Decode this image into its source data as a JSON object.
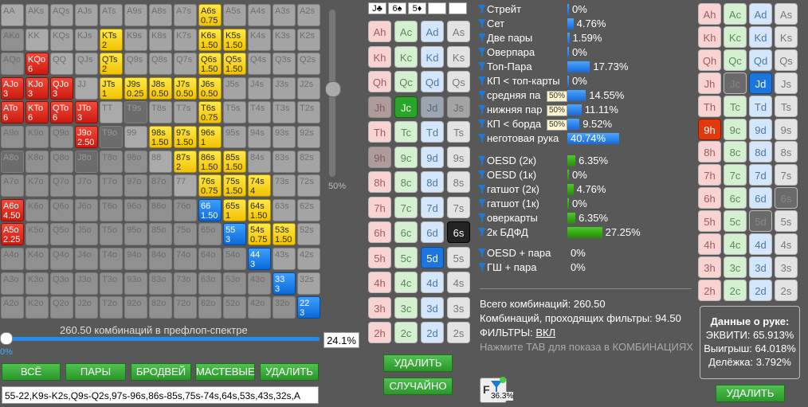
{
  "board": [
    "J♣",
    "6♠",
    "5♦",
    "",
    ""
  ],
  "preflop": {
    "summary": "260.50 комбинаций в префлоп-спектре",
    "percent": "24.1%",
    "vslider_label": "50%",
    "hslider_label": "0%"
  },
  "buttons": {
    "all": "ВСЁ",
    "pairs": "ПАРЫ",
    "broadway": "БРОДВЕЙ",
    "suited": "МАСТЕВЫЕ",
    "delete": "УДАЛИТЬ",
    "delete2": "УДАЛИТЬ",
    "random": "СЛУЧАЙНО",
    "delete3": "УДАЛИТЬ"
  },
  "range_text": "55-22,K9s-K2s,Q9s-Q2s,97s-96s,86s-85s,75s-74s,64s,53s,43s,32s,A",
  "stats": [
    {
      "label": "Стрейт",
      "value": "0%",
      "pct": 0
    },
    {
      "label": "Сет",
      "value": "4.76%",
      "pct": 4.76
    },
    {
      "label": "Две пары",
      "value": "1.59%",
      "pct": 1.59
    },
    {
      "label": "Оверпара",
      "value": "0%",
      "pct": 0
    },
    {
      "label": "Топ-Пара",
      "value": "17.73%",
      "pct": 17.73
    },
    {
      "label": "КП < топ-карты",
      "value": "0%",
      "pct": 0
    },
    {
      "label": "средняя па",
      "value": "14.55%",
      "pct": 14.55,
      "tag": "50%"
    },
    {
      "label": "нижняя пар",
      "value": "11.11%",
      "pct": 11.11,
      "tag": "50%"
    },
    {
      "label": "КП < борда",
      "value": "9.52%",
      "pct": 9.52,
      "tag": "50%"
    },
    {
      "label": "неготовая рука",
      "value": "40.74%",
      "pct": 40.74
    }
  ],
  "draws": [
    {
      "label": "OESD (2к)",
      "value": "6.35%",
      "pct": 6.35
    },
    {
      "label": "OESD (1к)",
      "value": "0%",
      "pct": 0
    },
    {
      "label": "гатшот (2к)",
      "value": "4.76%",
      "pct": 4.76
    },
    {
      "label": "гатшот (1к)",
      "value": "0%",
      "pct": 0
    },
    {
      "label": "оверкарты",
      "value": "6.35%",
      "pct": 6.35
    },
    {
      "label": "2к БДФД",
      "value": "27.25%",
      "pct": 27.25
    }
  ],
  "combos": [
    {
      "label": "OESD + пара",
      "value": "0%"
    },
    {
      "label": "ГШ + пара",
      "value": "0%"
    }
  ],
  "totals": {
    "total": "Всего комбинаций: 260.50",
    "passing": "Комбинаций, проходящих фильтры: 94.50",
    "filters_label": "ФИЛЬТРЫ:",
    "filters_value": "ВКЛ",
    "hint": "Нажмите TAB для показа в КОМБИНАЦИЯХ"
  },
  "filter_badge": "36.3%",
  "hand_data": {
    "title": "Данные о руке:",
    "equity": "ЭКВИТИ: 65.913%",
    "win": "Выигрыш: 64.018%",
    "tie": "Делёжка: 3.792%"
  },
  "ranks": [
    "A",
    "K",
    "Q",
    "J",
    "T",
    "9",
    "8",
    "7",
    "6",
    "5",
    "4",
    "3",
    "2"
  ],
  "matrix_marked": {
    "A6s": [
      "y",
      "0.75"
    ],
    "K6s": [
      "y",
      "1.50"
    ],
    "K5s": [
      "y",
      "1.50"
    ],
    "KTs": [
      "y",
      "2"
    ],
    "QTs": [
      "y",
      "2"
    ],
    "Q6s": [
      "y",
      "1.50"
    ],
    "Q5s": [
      "y",
      "1.50"
    ],
    "KQo": [
      "r",
      "6"
    ],
    "AJo": [
      "r",
      "3"
    ],
    "KJo": [
      "r",
      "3"
    ],
    "QJo": [
      "r",
      "3"
    ],
    "JTs": [
      "y",
      "1"
    ],
    "J9s": [
      "y",
      "0.25"
    ],
    "J8s": [
      "y",
      "0.50"
    ],
    "J7s": [
      "y",
      "0.50"
    ],
    "J6s": [
      "y",
      "0.50"
    ],
    "ATo": [
      "r",
      "6"
    ],
    "KTo": [
      "r",
      "6"
    ],
    "QTo": [
      "r",
      "6"
    ],
    "JTo": [
      "r",
      "3"
    ],
    "T6s": [
      "y",
      "0.75"
    ],
    "J9o": [
      "r",
      "2.50"
    ],
    "98s": [
      "y",
      "1.50"
    ],
    "97s": [
      "y",
      "1.50"
    ],
    "96s": [
      "y",
      "1"
    ],
    "87s": [
      "y",
      "2"
    ],
    "86s": [
      "y",
      "1.50"
    ],
    "85s": [
      "y",
      "1.50"
    ],
    "76s": [
      "y",
      "0.75"
    ],
    "75s": [
      "y",
      "1.50"
    ],
    "74s": [
      "y",
      "4"
    ],
    "A6o": [
      "r",
      "4.50"
    ],
    "66": [
      "b",
      "1.50"
    ],
    "65s": [
      "y",
      "1"
    ],
    "64s": [
      "y",
      "1.50"
    ],
    "A5o": [
      "r",
      "2.25"
    ],
    "55": [
      "b",
      "3"
    ],
    "54s": [
      "y",
      "0.75"
    ],
    "53s": [
      "y",
      "1.50"
    ],
    "44": [
      "b",
      "3"
    ],
    "33": [
      "b",
      "3"
    ],
    "22": [
      "b",
      "3"
    ]
  },
  "matrix_dark": [
    "A8o",
    "T9o",
    "J8o",
    "T9s"
  ],
  "suits_panel": {
    "ranks": [
      "A",
      "K",
      "Q",
      "J",
      "T",
      "9",
      "8",
      "7",
      "6",
      "5",
      "4",
      "3",
      "2"
    ],
    "suits": [
      "h",
      "c",
      "d",
      "s"
    ]
  }
}
